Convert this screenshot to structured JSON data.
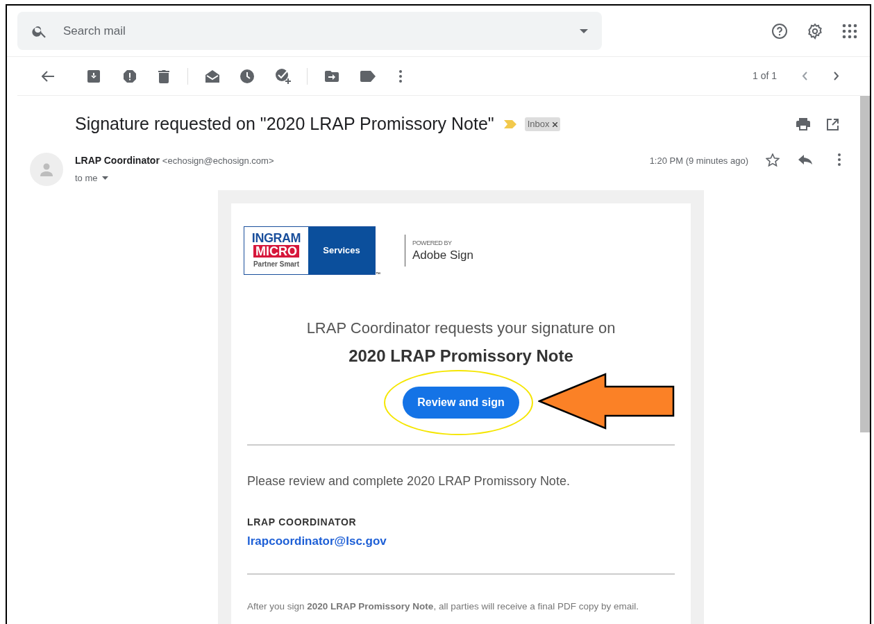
{
  "search": {
    "placeholder": "Search mail"
  },
  "toolbar": {
    "pagination": "1 of 1"
  },
  "message": {
    "subject": "Signature requested on \"2020 LRAP Promissory Note\"",
    "labels": [
      {
        "text": "Inbox"
      }
    ],
    "sender_name": "LRAP Coordinator",
    "sender_email": "<echosign@echosign.com>",
    "recipient": "to me",
    "time": "1:20 PM (9 minutes ago)"
  },
  "email_body": {
    "logo": {
      "line_1": "INGRAM",
      "line_2": "MICRO",
      "line_3": "Partner Smart",
      "panel": "Services",
      "trademark": "™"
    },
    "powered_by": "POWERED BY",
    "powered_brand": "Adobe Sign",
    "request_line": "LRAP Coordinator requests your signature on",
    "document_title": "2020 LRAP Promissory Note",
    "button": "Review and sign",
    "note": "Please review and complete 2020 LRAP Promissory Note.",
    "signer_name": "LRAP COORDINATOR",
    "signer_email": "lrapcoordinator@lsc.gov",
    "footer": "After you sign **2020 LRAP Promissory Note**, all parties will receive a final PDF copy by email."
  }
}
